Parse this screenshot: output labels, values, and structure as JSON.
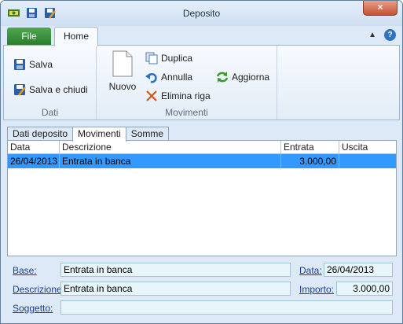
{
  "window": {
    "title": "Deposito",
    "close_label": "×"
  },
  "qat": {
    "icons": [
      "app-icon",
      "save-icon",
      "save-close-icon"
    ]
  },
  "ribbon_tabs": {
    "file": "File",
    "home": "Home"
  },
  "ribbon": {
    "dati": {
      "label": "Dati",
      "salva": "Salva",
      "salva_chiudi": "Salva e chiudi"
    },
    "movimenti": {
      "label": "Movimenti",
      "nuovo": "Nuovo",
      "duplica": "Duplica",
      "annulla": "Annulla",
      "elimina": "Elimina riga",
      "aggiorna": "Aggiorna"
    }
  },
  "doc_tabs": [
    "Dati deposito",
    "Movimenti",
    "Somme"
  ],
  "grid": {
    "columns": [
      "Data",
      "Descrizione",
      "Entrata",
      "Uscita"
    ],
    "rows": [
      {
        "data": "26/04/2013",
        "descrizione": "Entrata in banca",
        "entrata": "3.000,00",
        "uscita": ""
      }
    ]
  },
  "form": {
    "base_label": "Base:",
    "base_value": "Entrata in banca",
    "descrizione_label": "Descrizione:",
    "descrizione_value": "Entrata in banca",
    "soggetto_label": "Soggetto:",
    "soggetto_value": "",
    "data_label": "Data:",
    "data_value": "26/04/2013",
    "importo_label": "Importo:",
    "importo_value": "3.000,00"
  },
  "colors": {
    "accent_selection": "#3399ff",
    "file_tab": "#2b7a2b",
    "label_blue": "#1f3d8c"
  }
}
